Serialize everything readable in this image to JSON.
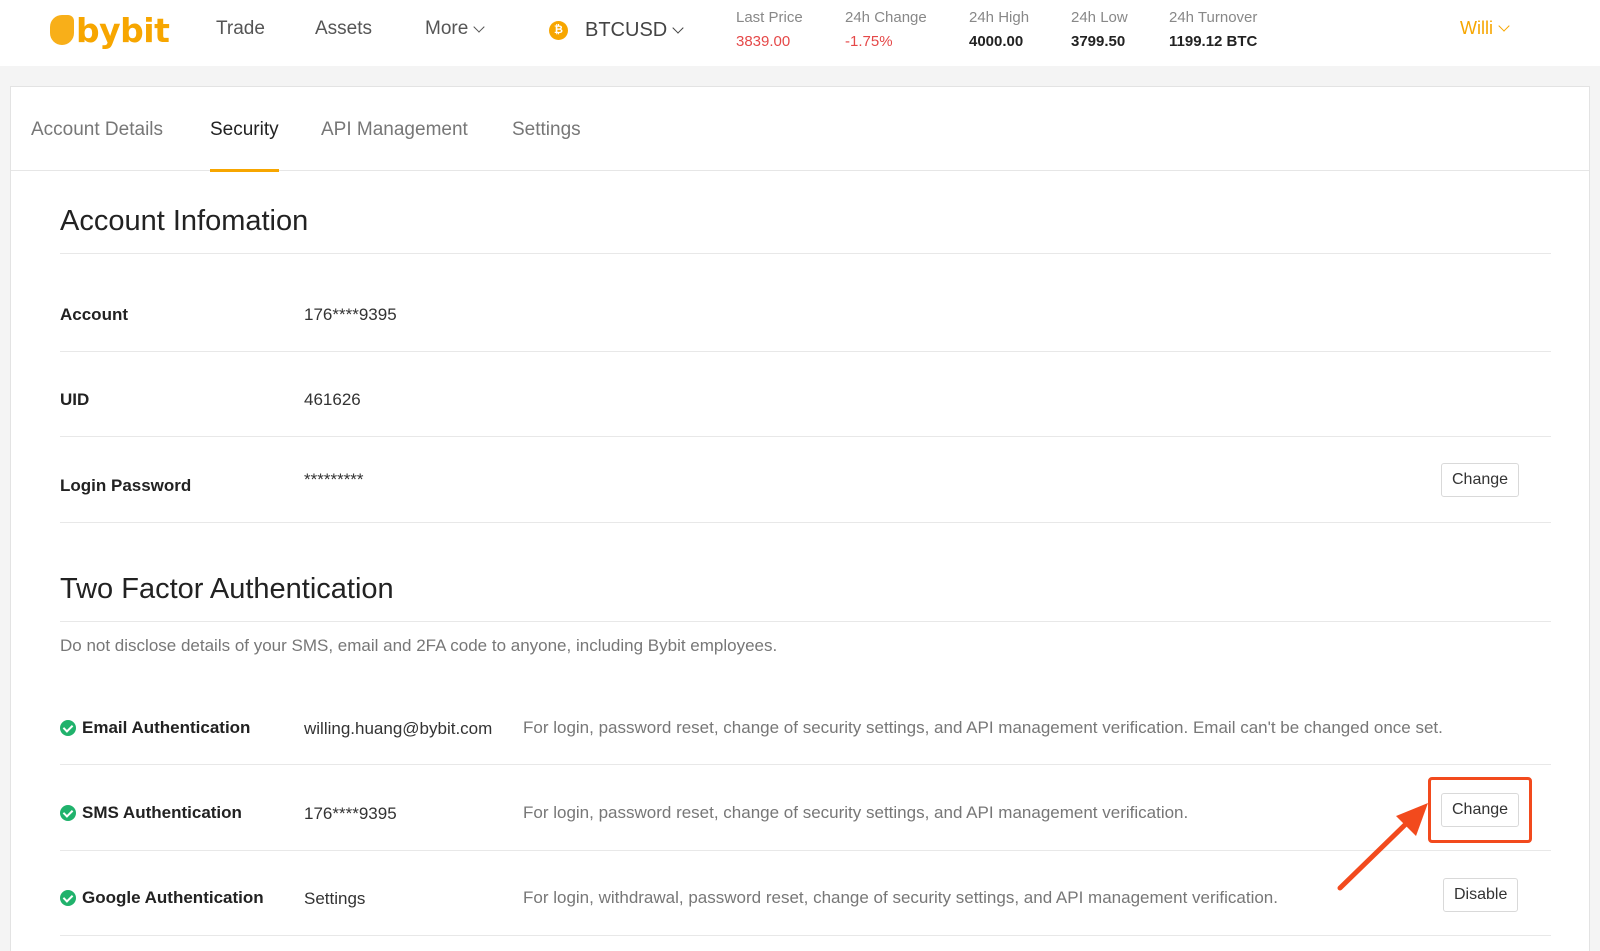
{
  "header": {
    "logo_text": "bybit",
    "nav": [
      {
        "label": "Trade"
      },
      {
        "label": "Assets"
      },
      {
        "label": "More"
      }
    ],
    "coin_glyph": "₿",
    "symbol": "BTCUSD",
    "stats": [
      {
        "label": "Last Price",
        "value": "3839.00"
      },
      {
        "label": "24h Change",
        "value": "-1.75%"
      },
      {
        "label": "24h High",
        "value": "4000.00"
      },
      {
        "label": "24h Low",
        "value": "3799.50"
      },
      {
        "label": "24h Turnover",
        "value": "1199.12 BTC"
      }
    ],
    "user": "Willi"
  },
  "tabs": [
    {
      "label": "Account Details"
    },
    {
      "label": "Security",
      "active": true
    },
    {
      "label": "API Management"
    },
    {
      "label": "Settings"
    }
  ],
  "account_info": {
    "title": "Account Infomation",
    "rows": [
      {
        "label": "Account",
        "value": "176****9395"
      },
      {
        "label": "UID",
        "value": "461626"
      },
      {
        "label": "Login Password",
        "value": "*********",
        "action": "Change"
      }
    ]
  },
  "two_factor": {
    "title": "Two Factor Authentication",
    "note": "Do not disclose details of your SMS, email and 2FA code to anyone, including Bybit employees.",
    "rows": [
      {
        "label": "Email Authentication",
        "value": "willing.huang@bybit.com",
        "desc": "For login, password reset, change of security settings, and API management verification. Email can't be changed once set."
      },
      {
        "label": "SMS Authentication",
        "value": "176****9395",
        "desc": "For login, password reset, change of security settings, and API management verification.",
        "action": "Change"
      },
      {
        "label": "Google Authentication",
        "value": "Settings",
        "desc": "For login, withdrawal, password reset, change of security settings, and API management verification.",
        "action": "Disable"
      }
    ]
  },
  "colors": {
    "brand": "#f7a600",
    "negative": "#e54848",
    "success": "#20b26c",
    "annotation": "#f24a1d"
  }
}
